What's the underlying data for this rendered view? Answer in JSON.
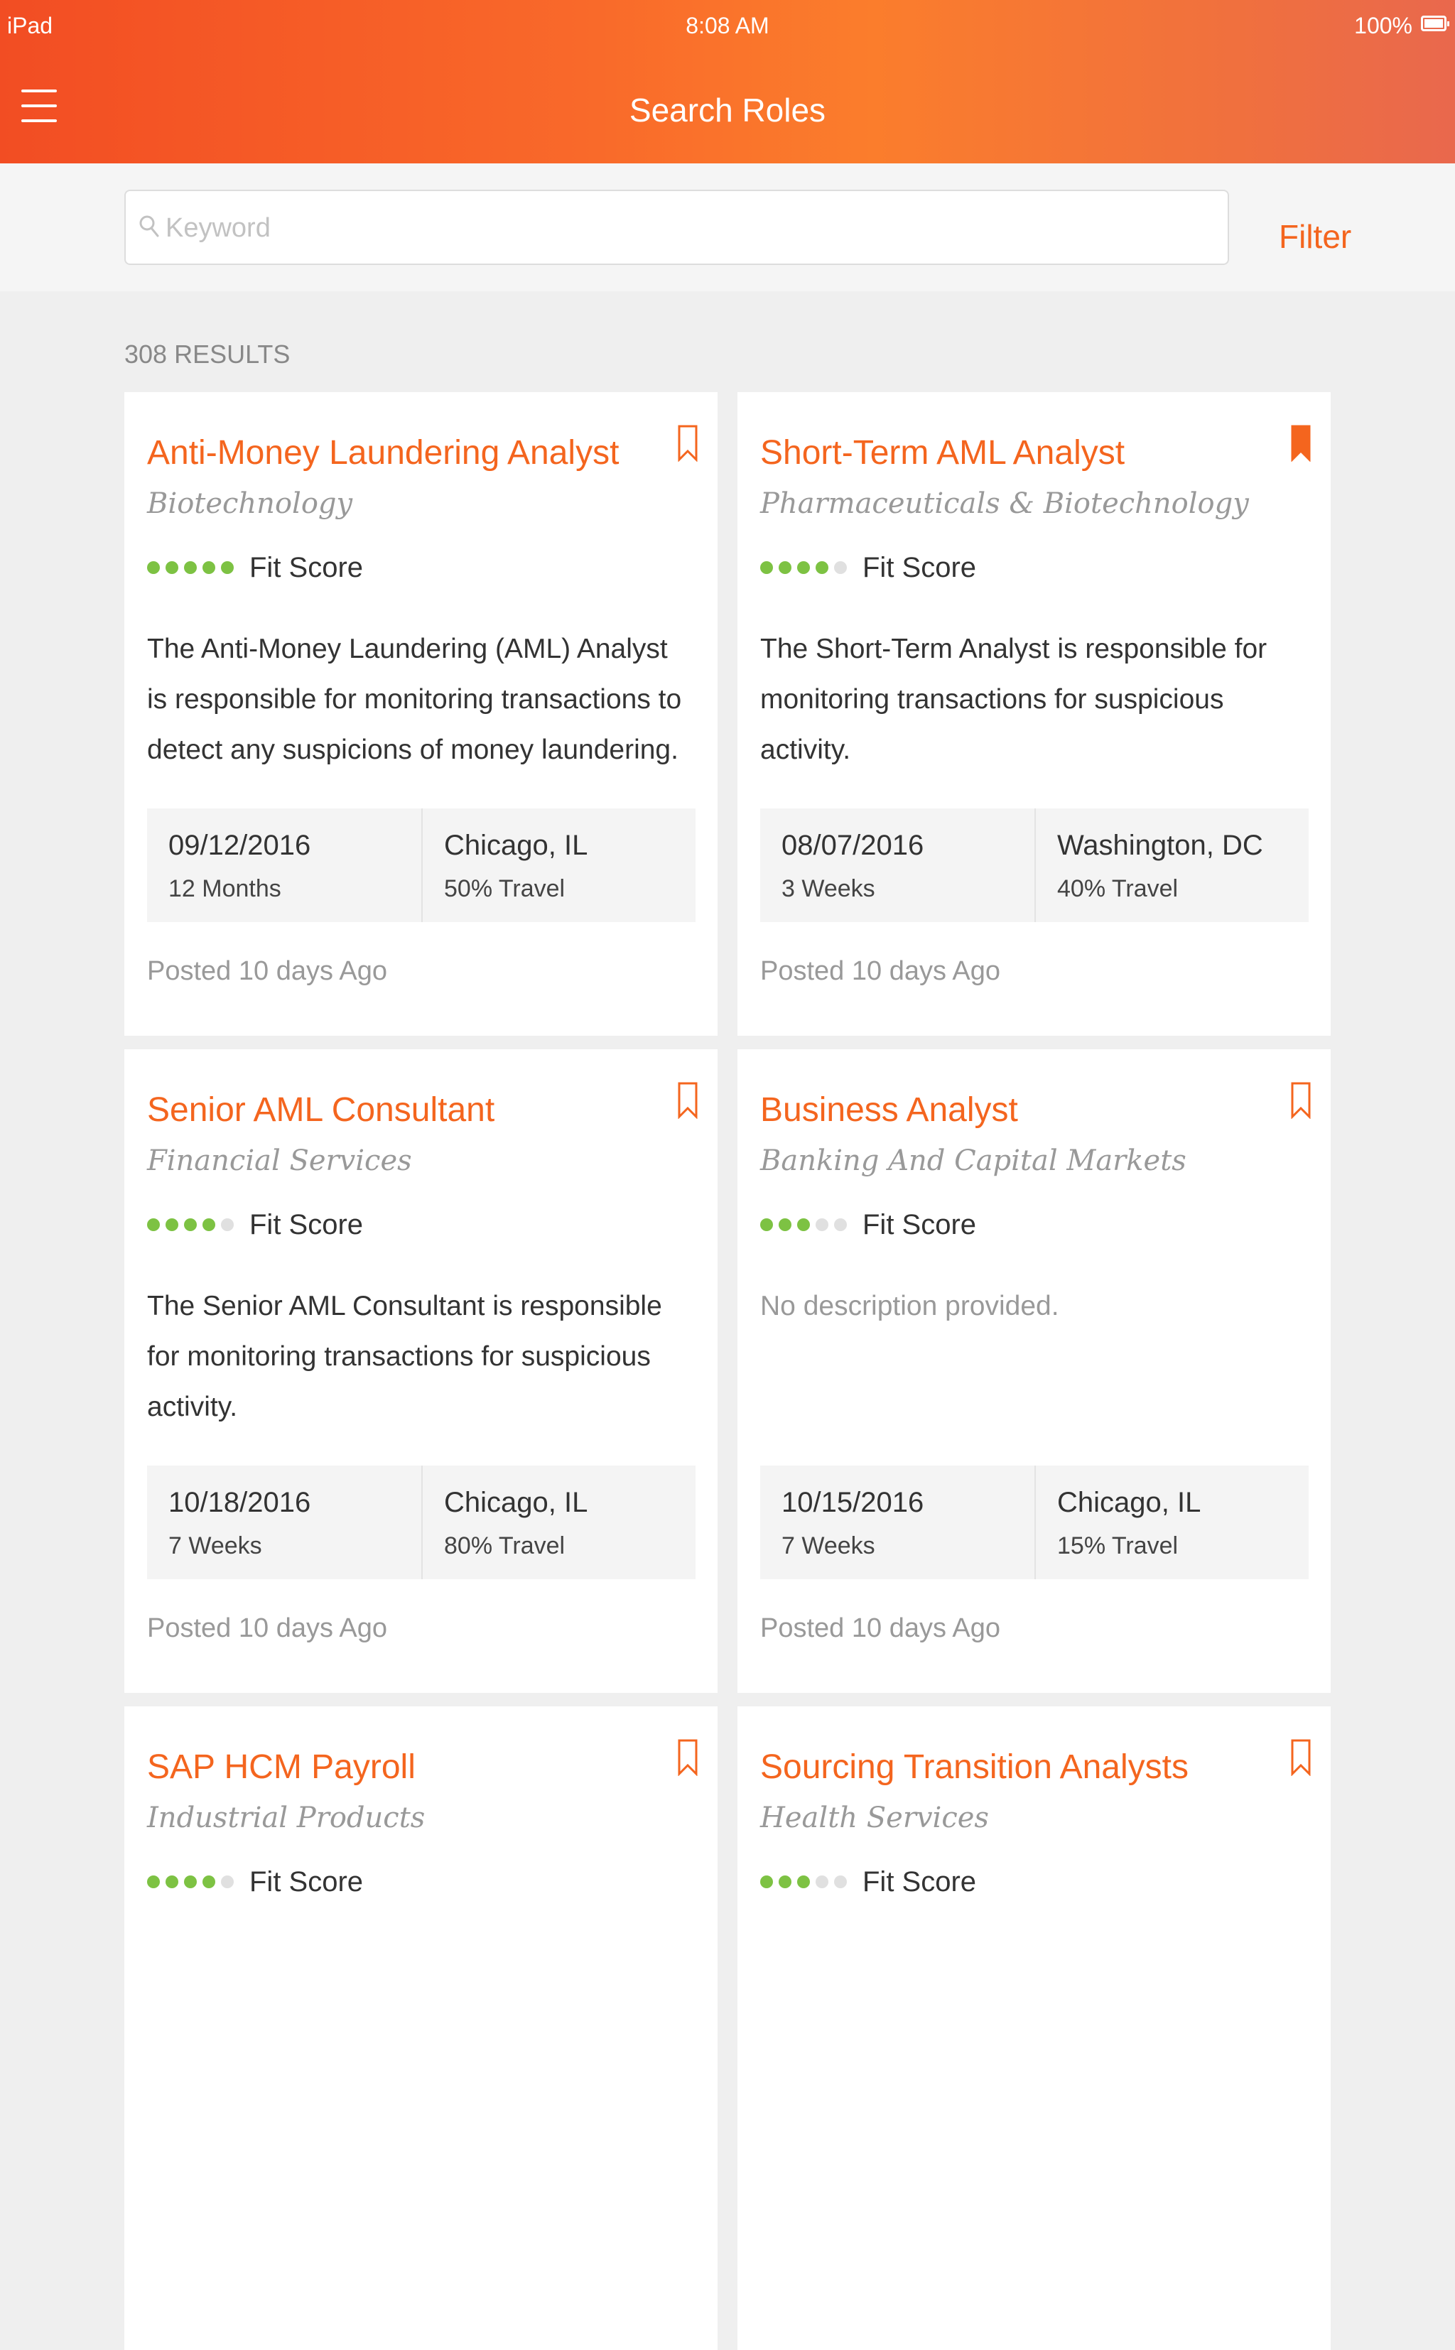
{
  "status_bar": {
    "device": "iPad",
    "time": "8:08 AM",
    "battery": "100%"
  },
  "header": {
    "title": "Search Roles"
  },
  "search": {
    "placeholder": "Keyword",
    "filter_label": "Filter"
  },
  "results": {
    "count_label": "308 RESULTS"
  },
  "colors": {
    "accent": "#f4651e",
    "fit_on": "#7dc243",
    "fit_off": "#e0e0e0"
  },
  "cards": [
    {
      "title": "Anti-Money Laundering Analyst",
      "industry": "Biotechnology",
      "fit_score": 5,
      "fit_max": 5,
      "fit_label": "Fit Score",
      "description": "The Anti-Money Laundering (AML) Analyst is responsible for monitoring transactions to detect any suspicions of money laundering.",
      "date": "09/12/2016",
      "duration": "12 Months",
      "location": "Chicago, IL",
      "travel": "50% Travel",
      "posted": "Posted 10 days Ago",
      "bookmarked": false
    },
    {
      "title": "Short-Term AML Analyst",
      "industry": "Pharmaceuticals & Biotechnology",
      "fit_score": 4,
      "fit_max": 5,
      "fit_label": "Fit Score",
      "description": "The Short-Term Analyst is responsible for monitoring transactions for suspicious activity.",
      "date": "08/07/2016",
      "duration": "3 Weeks",
      "location": "Washington, DC",
      "travel": "40% Travel",
      "posted": "Posted 10 days Ago",
      "bookmarked": true
    },
    {
      "title": "Senior AML Consultant",
      "industry": "Financial Services",
      "fit_score": 4,
      "fit_max": 5,
      "fit_label": "Fit Score",
      "description": "The Senior AML Consultant is responsible for monitoring transactions for suspicious activity.",
      "date": "10/18/2016",
      "duration": "7 Weeks",
      "location": "Chicago, IL",
      "travel": "80% Travel",
      "posted": "Posted 10 days Ago",
      "bookmarked": false
    },
    {
      "title": "Business Analyst",
      "industry": "Banking And Capital Markets",
      "fit_score": 3,
      "fit_max": 5,
      "fit_label": "Fit Score",
      "description": "No description provided.",
      "description_empty": true,
      "date": "10/15/2016",
      "duration": "7 Weeks",
      "location": "Chicago, IL",
      "travel": "15% Travel",
      "posted": "Posted 10 days Ago",
      "bookmarked": false
    },
    {
      "title": "SAP HCM Payroll",
      "industry": "Industrial Products",
      "fit_score": 4,
      "fit_max": 5,
      "fit_label": "Fit Score",
      "bookmarked": false
    },
    {
      "title": "Sourcing Transition Analysts",
      "industry": "Health Services",
      "fit_score": 3,
      "fit_max": 5,
      "fit_label": "Fit Score",
      "bookmarked": false
    }
  ]
}
